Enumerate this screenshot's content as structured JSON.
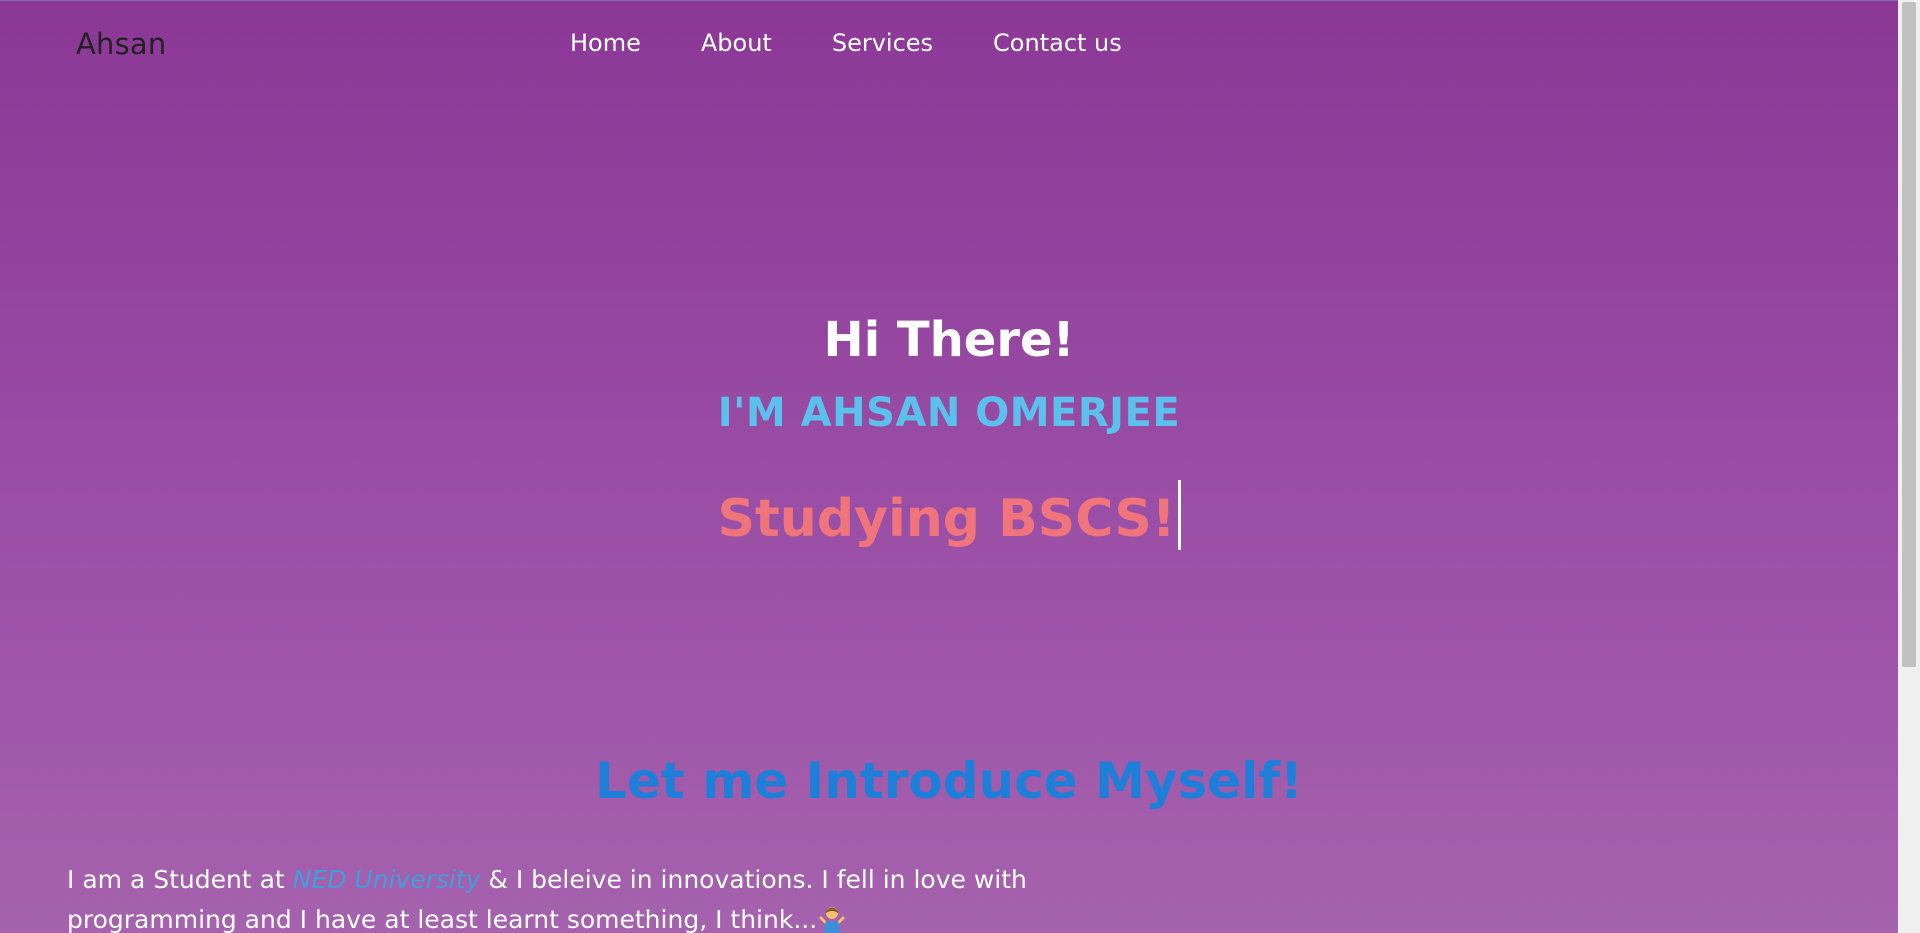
{
  "navbar": {
    "brand": "Ahsan",
    "links": [
      {
        "label": "Home"
      },
      {
        "label": "About"
      },
      {
        "label": "Services"
      },
      {
        "label": "Contact us"
      }
    ]
  },
  "hero": {
    "greeting": "Hi There!",
    "name": "I'M AHSAN OMERJEE",
    "typed_text": "Studying BSCS!"
  },
  "intro": {
    "title": "Let me Introduce Myself!",
    "text_before": "I am a Student at ",
    "highlight": "NED University",
    "text_after": " & I beleive in innovations. I fell in love with programming and I have at least learnt something, I think...",
    "emoji_icon": "person-shrugging-icon"
  },
  "colors": {
    "background_top": "#8c3796",
    "background_bottom": "#a562ad",
    "name_accent": "#5bc0eb",
    "typed_accent": "#f0747c",
    "intro_title": "#1d7fd8",
    "link_highlight": "#3f9fde"
  }
}
